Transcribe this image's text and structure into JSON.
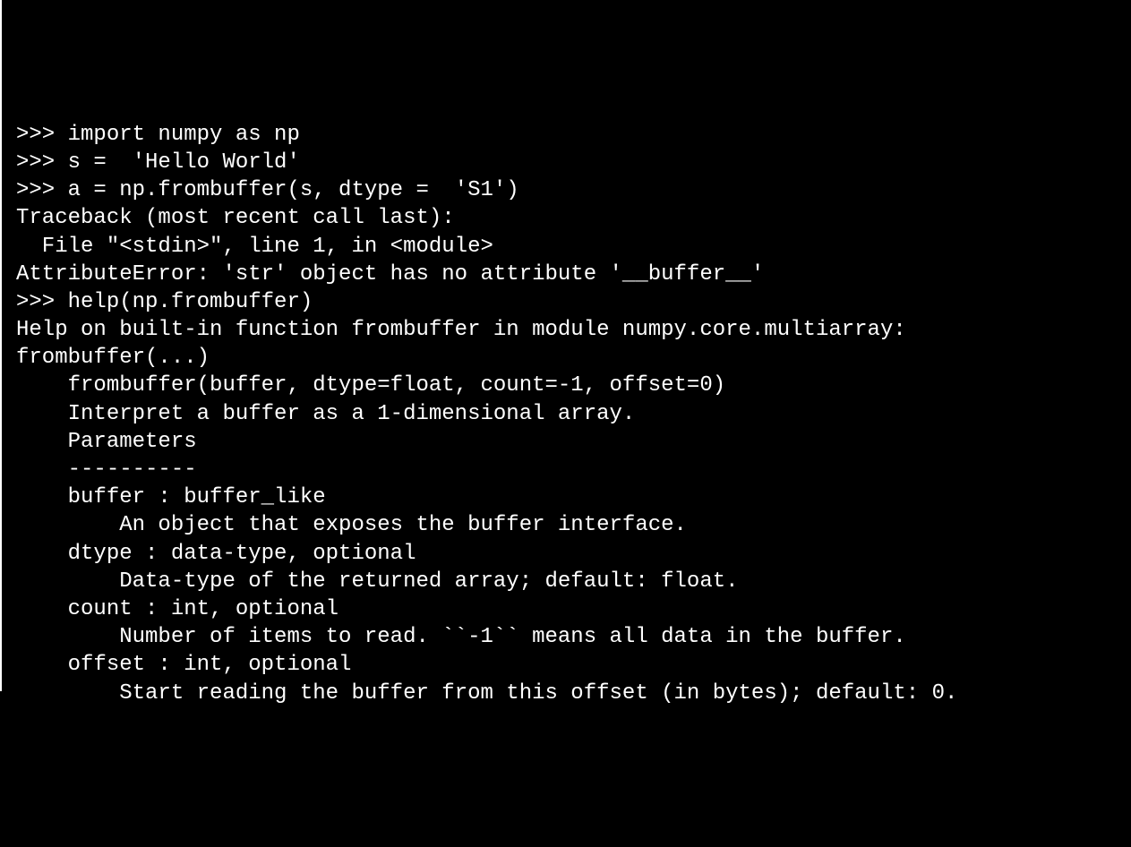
{
  "terminal": {
    "lines": [
      ">>> import numpy as np",
      ">>> s =  'Hello World'",
      ">>> a = np.frombuffer(s, dtype =  'S1')",
      "Traceback (most recent call last):",
      "  File \"<stdin>\", line 1, in <module>",
      "AttributeError: 'str' object has no attribute '__buffer__'",
      ">>> help(np.frombuffer)",
      "Help on built-in function frombuffer in module numpy.core.multiarray:",
      "",
      "frombuffer(...)",
      "    frombuffer(buffer, dtype=float, count=-1, offset=0)",
      "",
      "    Interpret a buffer as a 1-dimensional array.",
      "",
      "    Parameters",
      "    ----------",
      "    buffer : buffer_like",
      "        An object that exposes the buffer interface.",
      "    dtype : data-type, optional",
      "        Data-type of the returned array; default: float.",
      "    count : int, optional",
      "        Number of items to read. ``-1`` means all data in the buffer.",
      "    offset : int, optional",
      "        Start reading the buffer from this offset (in bytes); default: 0."
    ]
  }
}
